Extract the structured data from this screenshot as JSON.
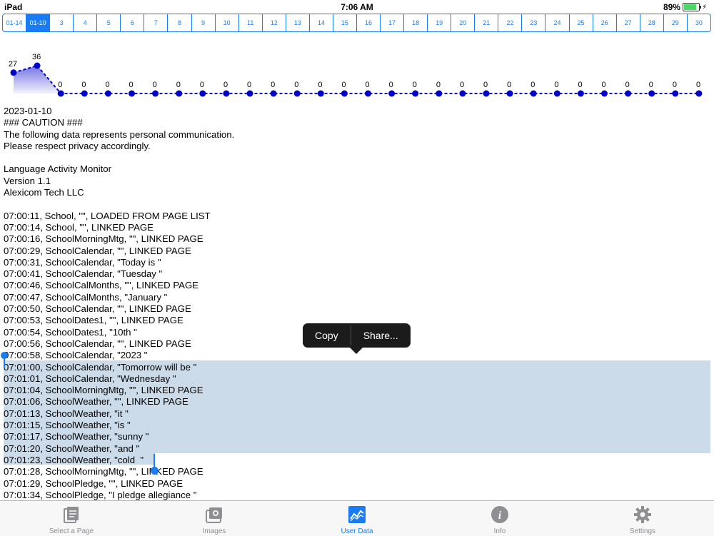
{
  "status_bar": {
    "device": "iPad",
    "time": "7:06 AM",
    "battery": "89%",
    "battery_level": 0.89
  },
  "date_tabs": {
    "active_index": 1,
    "items": [
      "01-14",
      "01-10",
      "3",
      "4",
      "5",
      "6",
      "7",
      "8",
      "9",
      "10",
      "11",
      "12",
      "13",
      "14",
      "15",
      "16",
      "17",
      "18",
      "19",
      "20",
      "21",
      "22",
      "23",
      "24",
      "25",
      "26",
      "27",
      "28",
      "29",
      "30"
    ]
  },
  "chart_data": {
    "type": "area",
    "x": [
      "01-14",
      "01-10",
      "3",
      "4",
      "5",
      "6",
      "7",
      "8",
      "9",
      "10",
      "11",
      "12",
      "13",
      "14",
      "15",
      "16",
      "17",
      "18",
      "19",
      "20",
      "21",
      "22",
      "23",
      "24",
      "25",
      "26",
      "27",
      "28",
      "29",
      "30"
    ],
    "values": [
      27,
      36,
      0,
      0,
      0,
      0,
      0,
      0,
      0,
      0,
      0,
      0,
      0,
      0,
      0,
      0,
      0,
      0,
      0,
      0,
      0,
      0,
      0,
      0,
      0,
      0,
      0,
      0,
      0,
      0
    ],
    "ylim": [
      0,
      36
    ],
    "grid": false,
    "line_color": "#0000cc",
    "fill_color": "#a9a9e0"
  },
  "log": {
    "lines": [
      "2023-01-10",
      "### CAUTION ###",
      "The following data represents personal communication.",
      "Please respect privacy accordingly.",
      "",
      "Language Activity Monitor",
      "Version 1.1",
      "Alexicom Tech LLC",
      "",
      "07:00:11, School, \"\", LOADED FROM PAGE LIST",
      "07:00:14, School, \"\", LINKED PAGE",
      "07:00:16, SchoolMorningMtg, \"\", LINKED PAGE",
      "07:00:29, SchoolCalendar, \"\", LINKED PAGE",
      "07:00:31, SchoolCalendar, \"Today is \"",
      "07:00:41, SchoolCalendar, \"Tuesday \"",
      "07:00:46, SchoolCalMonths, \"\", LINKED PAGE",
      "07:00:47, SchoolCalMonths, \"January \"",
      "07:00:50, SchoolCalendar, \"\", LINKED PAGE",
      "07:00:53, SchoolDates1, \"\", LINKED PAGE",
      "07:00:54, SchoolDates1, \"10th \"",
      "07:00:56, SchoolCalendar, \"\", LINKED PAGE",
      "07:00:58, SchoolCalendar, \"2023 \"",
      "07:01:00, SchoolCalendar, \"Tomorrow will be \"",
      "07:01:01, SchoolCalendar, \"Wednesday \"",
      "07:01:04, SchoolMorningMtg, \"\", LINKED PAGE",
      "07:01:06, SchoolWeather, \"\", LINKED PAGE",
      "07:01:13, SchoolWeather, \"it \"",
      "07:01:15, SchoolWeather, \"is \"",
      "07:01:17, SchoolWeather, \"sunny \"",
      "07:01:20, SchoolWeather, \"and \"",
      "07:01:23, SchoolWeather, \"cold  \"",
      "07:01:28, SchoolMorningMtg, \"\", LINKED PAGE",
      "07:01:29, SchoolPledge, \"\", LINKED PAGE",
      "07:01:34, SchoolPledge, \"I pledge allegiance \""
    ]
  },
  "context_menu": {
    "copy": "Copy",
    "share": "Share..."
  },
  "tab_bar": {
    "items": [
      {
        "label": "Select a Page",
        "icon": "pages-icon"
      },
      {
        "label": "Images",
        "icon": "camera-icon"
      },
      {
        "label": "User Data",
        "icon": "chart-icon"
      },
      {
        "label": "Info",
        "icon": "info-icon"
      },
      {
        "label": "Settings",
        "icon": "gear-icon"
      }
    ],
    "active_index": 2
  },
  "colors": {
    "accent": "#1a7cf2",
    "selection": "#ccdbea",
    "menu": "#1b1b1b"
  }
}
